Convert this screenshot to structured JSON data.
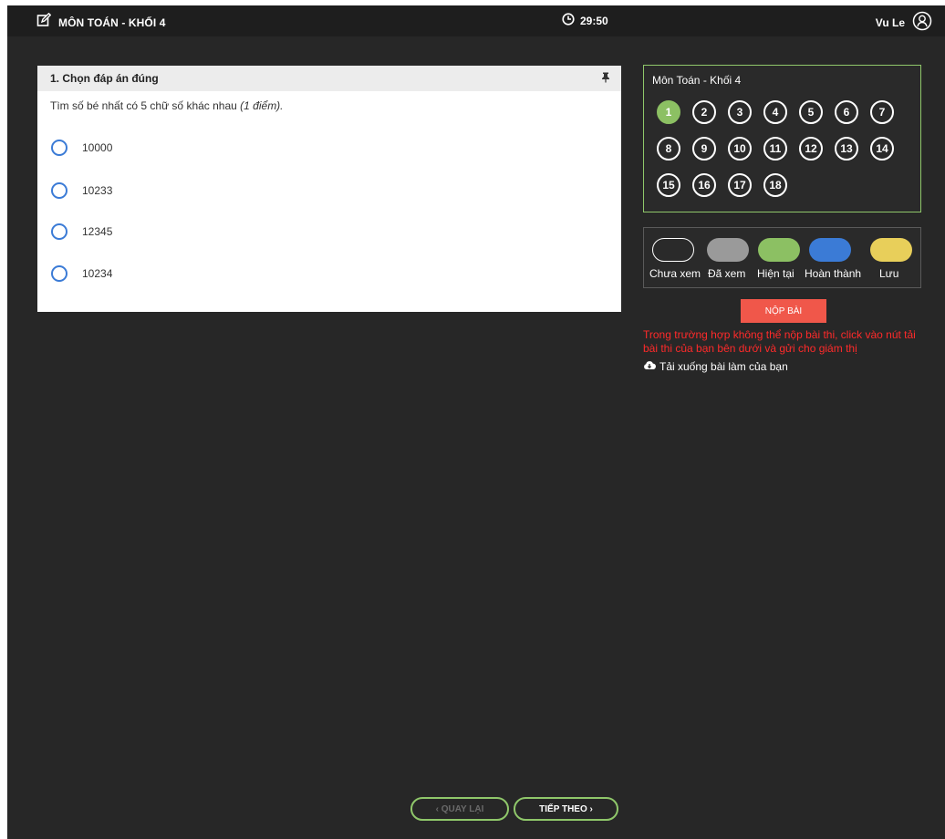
{
  "header": {
    "title": "MÔN TOÁN - KHỐI 4",
    "timer": "29:50",
    "user_name": "Vu Le"
  },
  "question": {
    "header": "1. Chọn đáp án đúng",
    "text": "Tìm số bé nhất có 5 chữ số khác nhau",
    "points": "(1 điểm).",
    "options": [
      "10000",
      "10233",
      "12345",
      "10234"
    ]
  },
  "navigator": {
    "title": "Môn Toán - Khối 4",
    "numbers": [
      "1",
      "2",
      "3",
      "4",
      "5",
      "6",
      "7",
      "8",
      "9",
      "10",
      "11",
      "12",
      "13",
      "14",
      "15",
      "16",
      "17",
      "18"
    ],
    "current": "1"
  },
  "legend": {
    "items": [
      {
        "label": "Chưa xem",
        "color": "#2a2a2a"
      },
      {
        "label": "Đã xem",
        "color": "#9a9a9a"
      },
      {
        "label": "Hiện tại",
        "color": "#8cc063"
      },
      {
        "label": "Hoàn thành",
        "color": "#3b7bd6"
      },
      {
        "label": "Lưu",
        "color": "#e8cf5a"
      }
    ]
  },
  "actions": {
    "submit_label": "NỘP BÀI",
    "warning": "Trong trường hợp không thể nộp bài thi, click vào nút tải bài thi của bạn bên dưới và gửi cho giám thị",
    "download_label": "Tải xuống bài làm của bạn",
    "prev_label": "‹ QUAY LẠI",
    "next_label": "TIẾP THEO ›"
  }
}
